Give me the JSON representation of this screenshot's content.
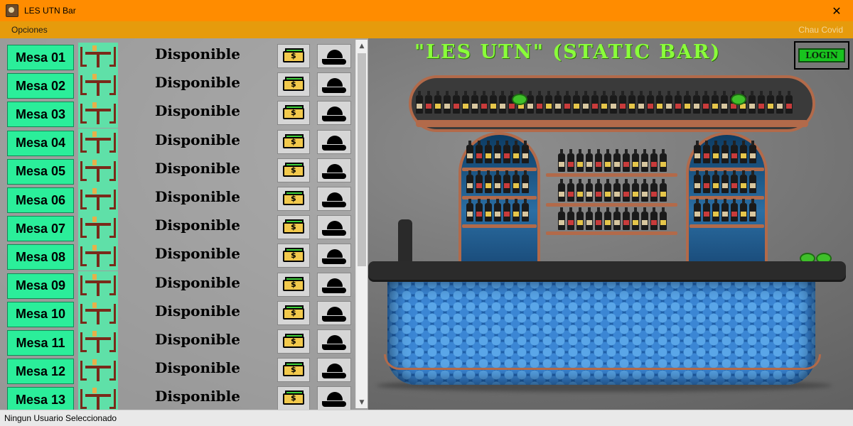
{
  "window": {
    "title": "LES UTN Bar",
    "close_glyph": "✕"
  },
  "menu": {
    "opciones": "Opciones",
    "chau": "Chau Covid"
  },
  "headline": "\"LES UTN\" (STATIC BAR)",
  "login_label": "LOGIN",
  "tables": [
    {
      "name": "Mesa 01",
      "status": "Disponible"
    },
    {
      "name": "Mesa 02",
      "status": "Disponible"
    },
    {
      "name": "Mesa 03",
      "status": "Disponible"
    },
    {
      "name": "Mesa 04",
      "status": "Disponible"
    },
    {
      "name": "Mesa 05",
      "status": "Disponible"
    },
    {
      "name": "Mesa 06",
      "status": "Disponible"
    },
    {
      "name": "Mesa 07",
      "status": "Disponible"
    },
    {
      "name": "Mesa 08",
      "status": "Disponible"
    },
    {
      "name": "Mesa 09",
      "status": "Disponible"
    },
    {
      "name": "Mesa 10",
      "status": "Disponible"
    },
    {
      "name": "Mesa 11",
      "status": "Disponible"
    },
    {
      "name": "Mesa 12",
      "status": "Disponible"
    },
    {
      "name": "Mesa 13",
      "status": "Disponible"
    }
  ],
  "icons": {
    "table": "table-chairs-icon",
    "money": "money-icon",
    "service": "serving-cloche-icon"
  },
  "colors": {
    "titlebar": "#ff8c00",
    "menubar": "#e69b0c",
    "mesa_button": "#2bee9a",
    "login": "#19c31f",
    "headline": "#8aff3a"
  },
  "status_bar": "Ningun Usuario Seleccionado"
}
